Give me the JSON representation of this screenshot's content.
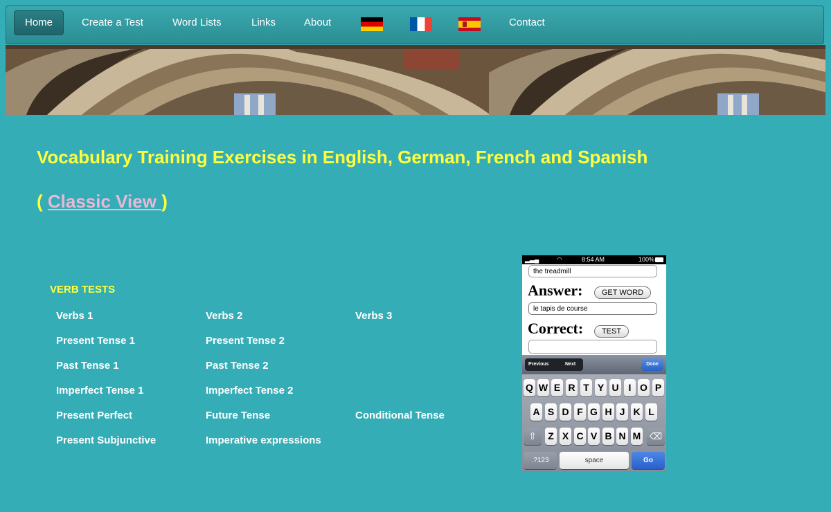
{
  "nav": {
    "home": "Home",
    "create_test": "Create a Test",
    "word_lists": "Word Lists",
    "links": "Links",
    "about": "About",
    "contact": "Contact"
  },
  "colors": {
    "background": "#35adb6",
    "title": "#ffff3d",
    "link": "#e9b8d8"
  },
  "main": {
    "title": "Vocabulary Training Exercises in English, German, French and Spanish",
    "classic_open": "( ",
    "classic_link": "Classic View ",
    "classic_close": ")"
  },
  "verb_tests": {
    "heading": "VERB TESTS",
    "items": [
      "Verbs 1",
      "Verbs 2",
      "Verbs 3",
      "Present Tense 1",
      "Present Tense 2",
      "Past Tense 1",
      "Past Tense 2",
      "Imperfect Tense 1",
      "Imperfect Tense 2",
      "Present Perfect",
      "Future Tense",
      "Conditional Tense",
      "Present Subjunctive",
      "Imperative expressions"
    ]
  },
  "phone": {
    "time": "8:54 AM",
    "battery": "100%",
    "question_value": "the treadmill",
    "answer_label": "Answer:",
    "get_word": "GET WORD",
    "answer_value": "le tapis de course",
    "correct_label": "Correct:",
    "test": "TEST",
    "previous": "Previous",
    "next": "Next",
    "done": "Done",
    "row1": [
      "Q",
      "W",
      "E",
      "R",
      "T",
      "Y",
      "U",
      "I",
      "O",
      "P"
    ],
    "row2": [
      "A",
      "S",
      "D",
      "F",
      "G",
      "H",
      "J",
      "K",
      "L"
    ],
    "row3": [
      "Z",
      "X",
      "C",
      "V",
      "B",
      "N",
      "M"
    ],
    "numbers": ".?123",
    "space": "space",
    "go": "Go"
  }
}
